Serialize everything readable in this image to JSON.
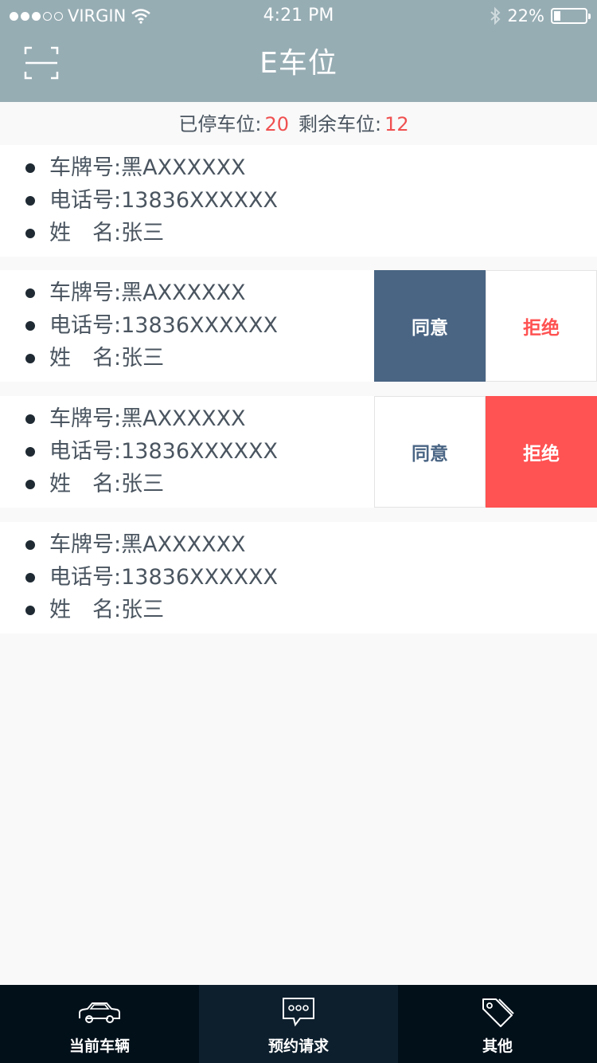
{
  "status_bar": {
    "carrier": "VIRGIN",
    "time": "4:21 PM",
    "battery": "22%",
    "battery_level": 0.22,
    "signal_bars_filled": 3,
    "signal_bars_total": 5
  },
  "nav": {
    "title": "E车位",
    "left_icon": "scan-icon"
  },
  "summary": {
    "parked_label": "已停车位:",
    "parked_value": "20",
    "remaining_label": "剩余车位:",
    "remaining_value": "12"
  },
  "requests": [
    {
      "plate_label": "车牌号:",
      "plate": "黑AXXXXXX",
      "phone_label": "电话号:",
      "phone": "13836XXXXXX",
      "name_label": "姓　名:",
      "name": "张三"
    },
    {
      "plate_label": "车牌号:",
      "plate": "黑AXXXXXX",
      "phone_label": "电话号:",
      "phone": "13836XXXXXX",
      "name_label": "姓　名:",
      "name": "张三",
      "agree": "同意",
      "reject": "拒绝"
    },
    {
      "plate_label": "车牌号:",
      "plate": "黑AXXXXXX",
      "phone_label": "电话号:",
      "phone": "13836XXXXXX",
      "name_label": "姓　名:",
      "name": "张三",
      "agree": "同意",
      "reject": "拒绝"
    },
    {
      "plate_label": "车牌号:",
      "plate": "黑AXXXXXX",
      "phone_label": "电话号:",
      "phone": "13836XXXXXX",
      "name_label": "姓　名:",
      "name": "张三"
    }
  ],
  "tabs": [
    {
      "label": "当前车辆",
      "icon": "car-icon",
      "active": false
    },
    {
      "label": "预约请求",
      "icon": "message-icon",
      "active": true
    },
    {
      "label": "其他",
      "icon": "tag-icon",
      "active": false
    }
  ],
  "colors": {
    "header": "#97adb4",
    "accent_red": "#f05050",
    "agree_dark": "#4a6584",
    "reject_red": "#ff5252",
    "tabbar": "#02101a"
  }
}
